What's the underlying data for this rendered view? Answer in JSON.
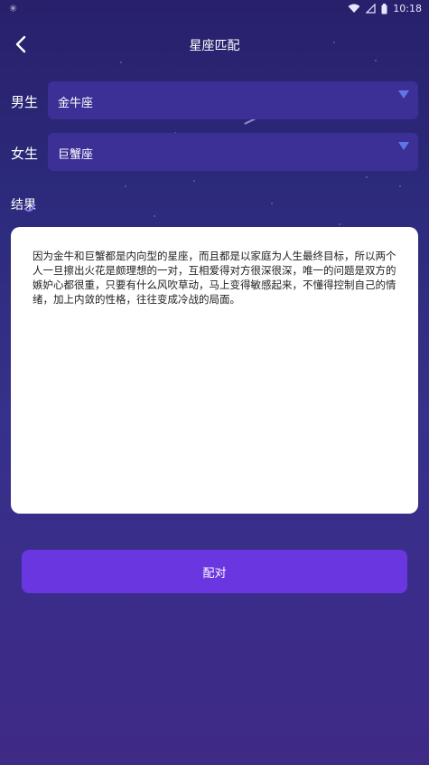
{
  "statusbar": {
    "left_icon": "✳",
    "time": "10:18"
  },
  "header": {
    "title": "星座匹配"
  },
  "male": {
    "label": "男生",
    "selected": "金牛座"
  },
  "female": {
    "label": "女生",
    "selected": "巨蟹座"
  },
  "result": {
    "label": "结果",
    "text": "因为金牛和巨蟹都是内向型的星座，而且都是以家庭为人生最终目标，所以两个人一旦擦出火花是颇理想的一对，互相爱得对方很深很深，唯一的问题是双方的嫉妒心都很重，只要有什么风吹草动，马上变得敏感起来，不懂得控制自己的情绪，加上内敛的性格，往往变成冷战的局面。"
  },
  "action": {
    "pair_label": "配对"
  },
  "colors": {
    "accent": "#6a36e0",
    "select_bg": "#3c2f96",
    "caret": "#5f76e8"
  }
}
